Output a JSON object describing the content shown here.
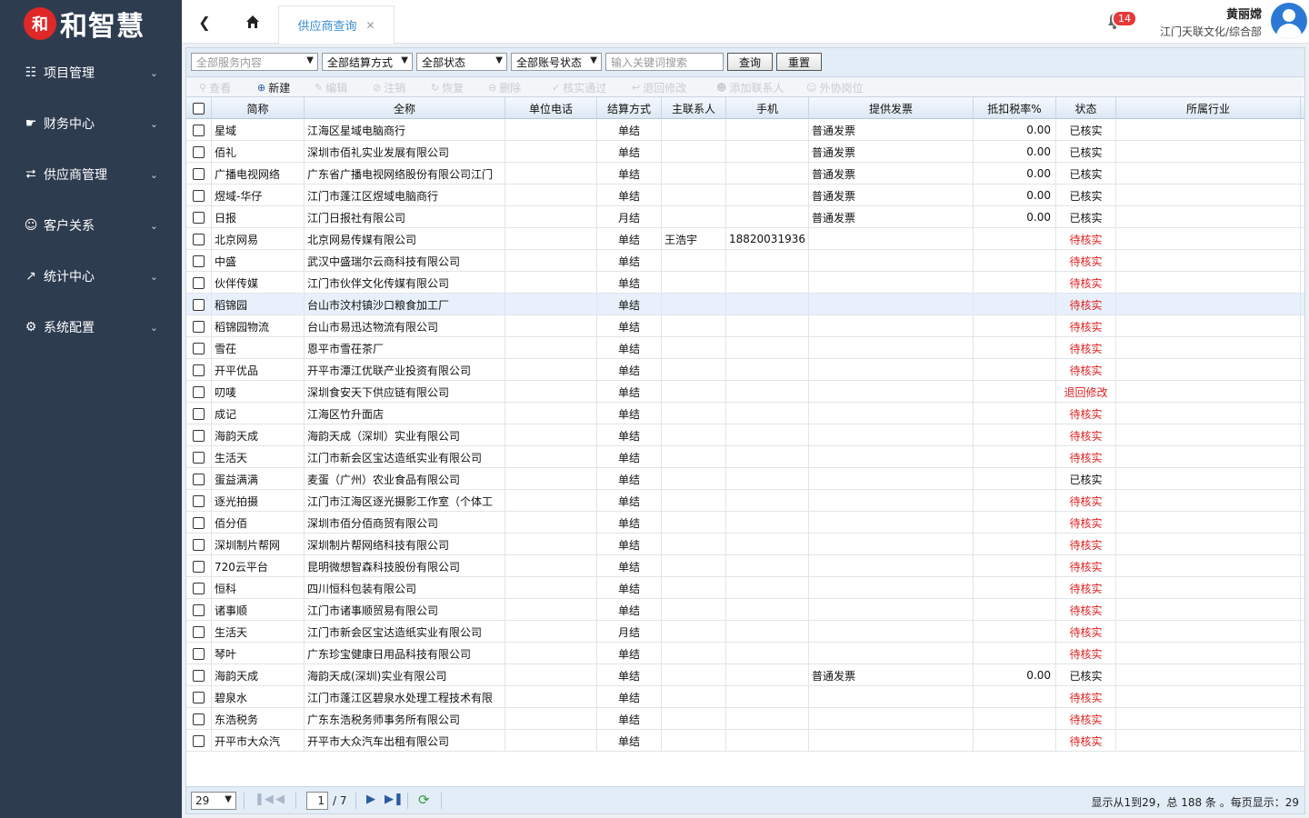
{
  "app": {
    "logo_mark": "和",
    "logo_text": "和智慧"
  },
  "sidebar": {
    "items": [
      {
        "label": "项目管理",
        "icon": "sitemap-icon"
      },
      {
        "label": "财务中心",
        "icon": "hand-coin-icon"
      },
      {
        "label": "供应商管理",
        "icon": "share-icon"
      },
      {
        "label": "客户关系",
        "icon": "users-icon"
      },
      {
        "label": "统计中心",
        "icon": "line-chart-icon"
      },
      {
        "label": "系统配置",
        "icon": "gears-icon"
      }
    ]
  },
  "header": {
    "tab_label": "供应商查询",
    "notification_count": "14",
    "user_name": "黄丽嫦",
    "user_org": "江门天联文化/综合部"
  },
  "search": {
    "service_placeholder": "全部服务内容",
    "settle": "全部结算方式",
    "status": "全部状态",
    "account_status": "全部账号状态",
    "keyword_placeholder": "输入关键词搜索",
    "query_label": "查询",
    "reset_label": "重置"
  },
  "toolbar": {
    "view": "查看",
    "new": "新建",
    "edit": "编辑",
    "cancel": "注销",
    "restore": "恢复",
    "delete": "删除",
    "verify": "核实通过",
    "return": "退回修改",
    "add_contact": "添加联系人",
    "external": "外协岗位"
  },
  "table": {
    "columns": [
      "简称",
      "全称",
      "单位电话",
      "结算方式",
      "主联系人",
      "手机",
      "提供发票",
      "抵扣税率%",
      "状态",
      "所属行业"
    ],
    "rows": [
      {
        "short": "星域",
        "full": "江海区星域电脑商行",
        "phone": "",
        "settle": "单结",
        "contact": "",
        "mobile": "",
        "invoice": "普通发票",
        "rate": "0.00",
        "status": "已核实",
        "industry": ""
      },
      {
        "short": "佰礼",
        "full": "深圳市佰礼实业发展有限公司",
        "phone": "",
        "settle": "单结",
        "contact": "",
        "mobile": "",
        "invoice": "普通发票",
        "rate": "0.00",
        "status": "已核实",
        "industry": ""
      },
      {
        "short": "广播电视网络",
        "full": "广东省广播电视网络股份有限公司江门",
        "phone": "",
        "settle": "单结",
        "contact": "",
        "mobile": "",
        "invoice": "普通发票",
        "rate": "0.00",
        "status": "已核实",
        "industry": ""
      },
      {
        "short": "煜域-华仔",
        "full": "江门市蓬江区煜域电脑商行",
        "phone": "",
        "settle": "单结",
        "contact": "",
        "mobile": "",
        "invoice": "普通发票",
        "rate": "0.00",
        "status": "已核实",
        "industry": ""
      },
      {
        "short": "日报",
        "full": "江门日报社有限公司",
        "phone": "",
        "settle": "月结",
        "contact": "",
        "mobile": "",
        "invoice": "普通发票",
        "rate": "0.00",
        "status": "已核实",
        "industry": ""
      },
      {
        "short": "北京网易",
        "full": "北京网易传媒有限公司",
        "phone": "",
        "settle": "单结",
        "contact": "王浩宇",
        "mobile": "18820031936",
        "invoice": "",
        "rate": "",
        "status": "待核实",
        "industry": ""
      },
      {
        "short": "中盛",
        "full": "武汉中盛瑞尔云商科技有限公司",
        "phone": "",
        "settle": "单结",
        "contact": "",
        "mobile": "",
        "invoice": "",
        "rate": "",
        "status": "待核实",
        "industry": ""
      },
      {
        "short": "伙伴传媒",
        "full": "江门市伙伴文化传媒有限公司",
        "phone": "",
        "settle": "单结",
        "contact": "",
        "mobile": "",
        "invoice": "",
        "rate": "",
        "status": "待核实",
        "industry": ""
      },
      {
        "short": "稻锦园",
        "full": "台山市汶村镇沙口粮食加工厂",
        "phone": "",
        "settle": "单结",
        "contact": "",
        "mobile": "",
        "invoice": "",
        "rate": "",
        "status": "待核实",
        "industry": ""
      },
      {
        "short": "稻锦园物流",
        "full": "台山市易迅达物流有限公司",
        "phone": "",
        "settle": "单结",
        "contact": "",
        "mobile": "",
        "invoice": "",
        "rate": "",
        "status": "待核实",
        "industry": ""
      },
      {
        "short": "雪茌",
        "full": "恩平市雪茌茶厂",
        "phone": "",
        "settle": "单结",
        "contact": "",
        "mobile": "",
        "invoice": "",
        "rate": "",
        "status": "待核实",
        "industry": ""
      },
      {
        "short": "开平优品",
        "full": "开平市潭江优联产业投资有限公司",
        "phone": "",
        "settle": "单结",
        "contact": "",
        "mobile": "",
        "invoice": "",
        "rate": "",
        "status": "待核实",
        "industry": ""
      },
      {
        "short": "叨唛",
        "full": "深圳食安天下供应链有限公司",
        "phone": "",
        "settle": "单结",
        "contact": "",
        "mobile": "",
        "invoice": "",
        "rate": "",
        "status": "退回修改",
        "industry": ""
      },
      {
        "short": "成记",
        "full": "江海区竹升面店",
        "phone": "",
        "settle": "单结",
        "contact": "",
        "mobile": "",
        "invoice": "",
        "rate": "",
        "status": "待核实",
        "industry": ""
      },
      {
        "short": "海韵天成",
        "full": "海韵天成（深圳）实业有限公司",
        "phone": "",
        "settle": "单结",
        "contact": "",
        "mobile": "",
        "invoice": "",
        "rate": "",
        "status": "待核实",
        "industry": ""
      },
      {
        "short": "生活天",
        "full": "江门市新会区宝达造纸实业有限公司",
        "phone": "",
        "settle": "单结",
        "contact": "",
        "mobile": "",
        "invoice": "",
        "rate": "",
        "status": "待核实",
        "industry": ""
      },
      {
        "short": "蛋益满满",
        "full": "麦蛋（广州）农业食品有限公司",
        "phone": "",
        "settle": "单结",
        "contact": "",
        "mobile": "",
        "invoice": "",
        "rate": "",
        "status": "已核实",
        "industry": ""
      },
      {
        "short": "逐光拍摄",
        "full": "江门市江海区逐光摄影工作室（个体工",
        "phone": "",
        "settle": "单结",
        "contact": "",
        "mobile": "",
        "invoice": "",
        "rate": "",
        "status": "待核实",
        "industry": ""
      },
      {
        "short": "佰分佰",
        "full": "深圳市佰分佰商贸有限公司",
        "phone": "",
        "settle": "单结",
        "contact": "",
        "mobile": "",
        "invoice": "",
        "rate": "",
        "status": "待核实",
        "industry": ""
      },
      {
        "short": "深圳制片帮网",
        "full": "深圳制片帮网络科技有限公司",
        "phone": "",
        "settle": "单结",
        "contact": "",
        "mobile": "",
        "invoice": "",
        "rate": "",
        "status": "待核实",
        "industry": ""
      },
      {
        "short": "720云平台",
        "full": "昆明微想智森科技股份有限公司",
        "phone": "",
        "settle": "单结",
        "contact": "",
        "mobile": "",
        "invoice": "",
        "rate": "",
        "status": "待核实",
        "industry": ""
      },
      {
        "short": "恒科",
        "full": "四川恒科包装有限公司",
        "phone": "",
        "settle": "单结",
        "contact": "",
        "mobile": "",
        "invoice": "",
        "rate": "",
        "status": "待核实",
        "industry": ""
      },
      {
        "short": "诸事顺",
        "full": "江门市诸事顺贸易有限公司",
        "phone": "",
        "settle": "单结",
        "contact": "",
        "mobile": "",
        "invoice": "",
        "rate": "",
        "status": "待核实",
        "industry": ""
      },
      {
        "short": "生活天",
        "full": "江门市新会区宝达造纸实业有限公司",
        "phone": "",
        "settle": "月结",
        "contact": "",
        "mobile": "",
        "invoice": "",
        "rate": "",
        "status": "待核实",
        "industry": ""
      },
      {
        "short": "琴叶",
        "full": "广东珍宝健康日用品科技有限公司",
        "phone": "",
        "settle": "单结",
        "contact": "",
        "mobile": "",
        "invoice": "",
        "rate": "",
        "status": "待核实",
        "industry": ""
      },
      {
        "short": "海韵天成",
        "full": "海韵天成(深圳)实业有限公司",
        "phone": "",
        "settle": "单结",
        "contact": "",
        "mobile": "",
        "invoice": "普通发票",
        "rate": "0.00",
        "status": "已核实",
        "industry": ""
      },
      {
        "short": "碧泉水",
        "full": "江门市蓬江区碧泉水处理工程技术有限",
        "phone": "",
        "settle": "单结",
        "contact": "",
        "mobile": "",
        "invoice": "",
        "rate": "",
        "status": "待核实",
        "industry": ""
      },
      {
        "short": "东浩税务",
        "full": "广东东浩税务师事务所有限公司",
        "phone": "",
        "settle": "单结",
        "contact": "",
        "mobile": "",
        "invoice": "",
        "rate": "",
        "status": "待核实",
        "industry": ""
      },
      {
        "short": "开平市大众汽",
        "full": "开平市大众汽车出租有限公司",
        "phone": "",
        "settle": "单结",
        "contact": "",
        "mobile": "",
        "invoice": "",
        "rate": "",
        "status": "待核实",
        "industry": ""
      }
    ],
    "highlighted_row": 8
  },
  "pager": {
    "page_size": "29",
    "current_page": "1",
    "total_pages": "/ 7",
    "info": "显示从1到29，总 188 条 。每页显示：29"
  },
  "colors": {
    "sidebar": "#2e3c50",
    "accent": "#3c8dce",
    "pending": "#e02020",
    "badge": "#e5393b"
  }
}
